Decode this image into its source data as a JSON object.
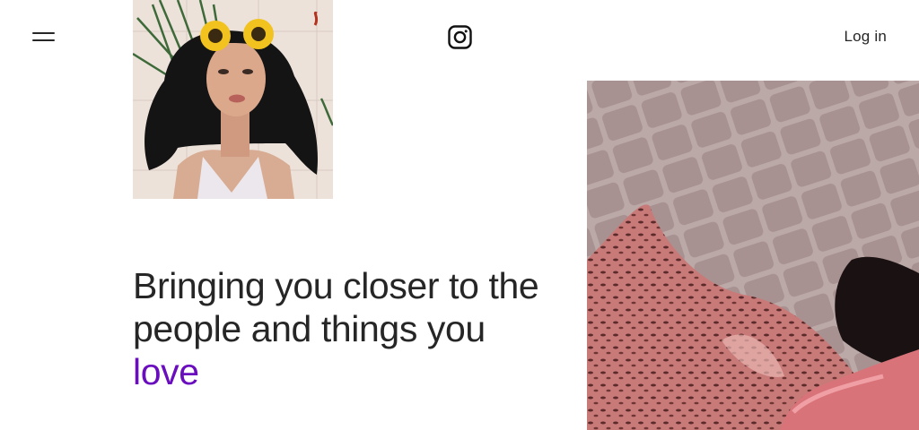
{
  "header": {
    "menu_icon": "hamburger-menu-icon",
    "logo_icon": "instagram-logo-icon",
    "login_label": "Log in"
  },
  "hero": {
    "headline_part1": "Bringing you closer to the people and things you ",
    "headline_accent": "love",
    "accent_color": "#6a0dbf"
  },
  "images": {
    "portrait": "illustrated-portrait-with-sunflowers",
    "street": "patterned-dress-on-cobblestones"
  }
}
